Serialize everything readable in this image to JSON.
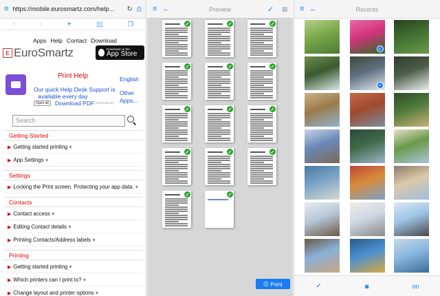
{
  "browser": {
    "url": "https://mobile.eurosmartz.com/help...",
    "nav_links": [
      "Apps",
      "Help",
      "Contact",
      "Download"
    ],
    "logo_text": "EuroSmartz",
    "appstore_small": "Download on the",
    "appstore_big": "App Store",
    "print_help": {
      "title": "Print Help",
      "line1": "Our quick Help Desk Support is",
      "line2": "available every day",
      "pdf": "Download PDF",
      "date": "(2019-09-20)",
      "open_all": "Open all",
      "english": "English",
      "other": "Other Apps..."
    },
    "search_placeholder": "Search",
    "sections": [
      {
        "title": "Getting Started",
        "items": [
          "Getting started printing +",
          "App Settings +"
        ]
      },
      {
        "title": "Settings",
        "items": [
          "Locking the Print screen. Protecting your app data. +"
        ]
      },
      {
        "title": "Contacts",
        "items": [
          "Contact access +",
          "Editing Contact details +",
          "Printing Contacts/Address labels +"
        ]
      },
      {
        "title": "Printing",
        "items": [
          "Getting started printing +",
          "Which printers can I print to? +",
          "Change layout and printer options +"
        ]
      }
    ]
  },
  "preview": {
    "title": "Preview",
    "page_count": 14,
    "print_label": "Print",
    "accent": "#1a7cf2",
    "check_color": "#2aa52a"
  },
  "recents": {
    "title": "Recents",
    "photos": [
      {
        "name": "green-hills",
        "colors": [
          "#7aa84a",
          "#4f7a35",
          "#b7cf8b"
        ],
        "selected": false
      },
      {
        "name": "pink-flowers",
        "colors": [
          "#d2337a",
          "#2f6b2a",
          "#e868a8"
        ],
        "selected": true
      },
      {
        "name": "hobbit-door",
        "colors": [
          "#3f6f32",
          "#6c9a4a",
          "#2a3d1f"
        ],
        "selected": false
      },
      {
        "name": "waterfall",
        "colors": [
          "#3a5a2f",
          "#d8e6e8",
          "#6f8c4c"
        ],
        "selected": false
      },
      {
        "name": "cliff-falls",
        "colors": [
          "#5d6f7f",
          "#dfe8ee",
          "#3e4a3a"
        ],
        "selected": true
      },
      {
        "name": "river-falls",
        "colors": [
          "#4e5e4a",
          "#e9eef0",
          "#2d3a2e"
        ],
        "selected": false
      },
      {
        "name": "coast-cliffs",
        "colors": [
          "#9c7a4a",
          "#8fb3d0",
          "#c9b38a"
        ],
        "selected": false
      },
      {
        "name": "red-beach",
        "colors": [
          "#a04a30",
          "#7c8c9c",
          "#c46a45"
        ],
        "selected": false
      },
      {
        "name": "garden-pot",
        "colors": [
          "#4f7a3a",
          "#c8b07a",
          "#2d4d2a"
        ],
        "selected": false
      },
      {
        "name": "clock-tower",
        "colors": [
          "#6a88b8",
          "#7c6a5a",
          "#c9d4e4"
        ],
        "selected": false
      },
      {
        "name": "mountain-lake",
        "colors": [
          "#3f6a4a",
          "#9fb4c8",
          "#2d4a3a"
        ],
        "selected": false
      },
      {
        "name": "swiss-village",
        "colors": [
          "#6a9a4a",
          "#a9c4dc",
          "#e8e0cc"
        ],
        "selected": false
      },
      {
        "name": "lake-chateau",
        "colors": [
          "#7aa4c8",
          "#d8d8d0",
          "#4a7aa0"
        ],
        "selected": false
      },
      {
        "name": "canal-houses",
        "colors": [
          "#d88a3a",
          "#7aa4c8",
          "#b84a3a"
        ],
        "selected": false
      },
      {
        "name": "church-dome",
        "colors": [
          "#dcc8a8",
          "#9fbfdf",
          "#8a7a6a"
        ],
        "selected": false
      },
      {
        "name": "eiffel-tower",
        "colors": [
          "#b8c8d8",
          "#6a5a4a",
          "#e6ecf2"
        ],
        "selected": false
      },
      {
        "name": "grand-building",
        "colors": [
          "#cfd8e4",
          "#8a8a8a",
          "#f0ece4"
        ],
        "selected": false
      },
      {
        "name": "horse-statue",
        "colors": [
          "#9ec4e6",
          "#4a4a4a",
          "#dce8f2"
        ],
        "selected": false
      },
      {
        "name": "ornate-pavilion",
        "colors": [
          "#8ab0d8",
          "#c8a880",
          "#6a5a48"
        ],
        "selected": false
      },
      {
        "name": "seaside-crowd",
        "colors": [
          "#4a90d0",
          "#d8a840",
          "#2a5a8a"
        ],
        "selected": false
      },
      {
        "name": "harbor-boats",
        "colors": [
          "#8ab8e0",
          "#3a6a9a",
          "#c8d8e8"
        ],
        "selected": false
      }
    ]
  }
}
